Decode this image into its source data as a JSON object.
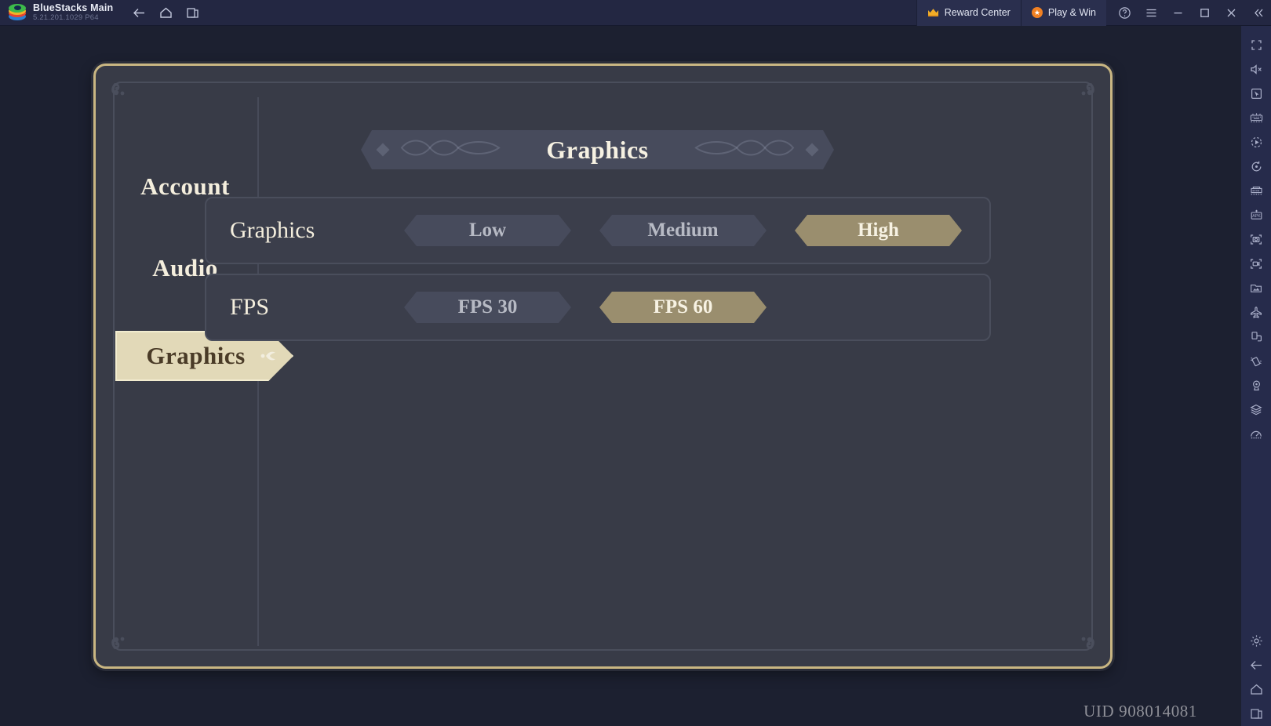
{
  "window": {
    "app_title": "BlueStacks Main",
    "app_version": "5.21.201.1029  P64",
    "nav": {
      "back": "back-arrow",
      "home": "home",
      "multi_window": "multi-window"
    },
    "reward_center": "Reward Center",
    "play_and_win": "Play & Win",
    "help": "?",
    "menu": "menu",
    "minimize": "minimize",
    "maximize": "maximize",
    "close": "close",
    "collapse": "collapse"
  },
  "right_rail": {
    "items": [
      {
        "name": "fullscreen-icon",
        "tip": "Fullscreen"
      },
      {
        "name": "mute-icon",
        "tip": "Mute"
      },
      {
        "name": "cursor-icon",
        "tip": "Cursor control"
      },
      {
        "name": "keyboard-controls-icon",
        "tip": "Game controls"
      },
      {
        "name": "macro-icon",
        "tip": "Macros"
      },
      {
        "name": "rotate-icon",
        "tip": "Rotate"
      },
      {
        "name": "multi-instance-icon",
        "tip": "Multi-instance"
      },
      {
        "name": "install-apk-icon",
        "tip": "Install APK"
      },
      {
        "name": "screenshot-icon",
        "tip": "Screenshot"
      },
      {
        "name": "screen-record-icon",
        "tip": "Record screen"
      },
      {
        "name": "media-manager-icon",
        "tip": "Media manager"
      },
      {
        "name": "airplane-mode-icon",
        "tip": "Airplane mode"
      },
      {
        "name": "copy-to-clipboard-icon",
        "tip": "Copy"
      },
      {
        "name": "shake-icon",
        "tip": "Shake"
      },
      {
        "name": "location-icon",
        "tip": "Location"
      },
      {
        "name": "eco-mode-icon",
        "tip": "Eco mode"
      },
      {
        "name": "performance-icon",
        "tip": "Performance"
      }
    ],
    "bottom_items": [
      {
        "name": "settings-gear-icon",
        "tip": "Settings"
      },
      {
        "name": "back-arrow-icon",
        "tip": "Back"
      },
      {
        "name": "home-icon",
        "tip": "Home"
      },
      {
        "name": "recent-apps-icon",
        "tip": "Recent apps"
      }
    ]
  },
  "game": {
    "sidebar": {
      "items": [
        {
          "label": "Account",
          "selected": false
        },
        {
          "label": "Audio",
          "selected": false
        },
        {
          "label": "Graphics",
          "selected": true
        }
      ]
    },
    "header_title": "Graphics",
    "rows": [
      {
        "label": "Graphics",
        "options": [
          {
            "label": "Low",
            "selected": false
          },
          {
            "label": "Medium",
            "selected": false
          },
          {
            "label": "High",
            "selected": true
          }
        ]
      },
      {
        "label": "FPS",
        "options": [
          {
            "label": "FPS 30",
            "selected": false
          },
          {
            "label": "FPS 60",
            "selected": true
          }
        ]
      }
    ],
    "uid": "UID 908014081"
  },
  "colors": {
    "topbar": "#232742",
    "rail": "#262b4b",
    "backdrop": "#1c2030",
    "panel": "#383b47",
    "gold_border": "#c9b682",
    "selected_option": "#9a8e6e",
    "inactive_option": "#474b5c",
    "banner_cream": "#e2d9b8",
    "accent_orange": "#f08022"
  }
}
